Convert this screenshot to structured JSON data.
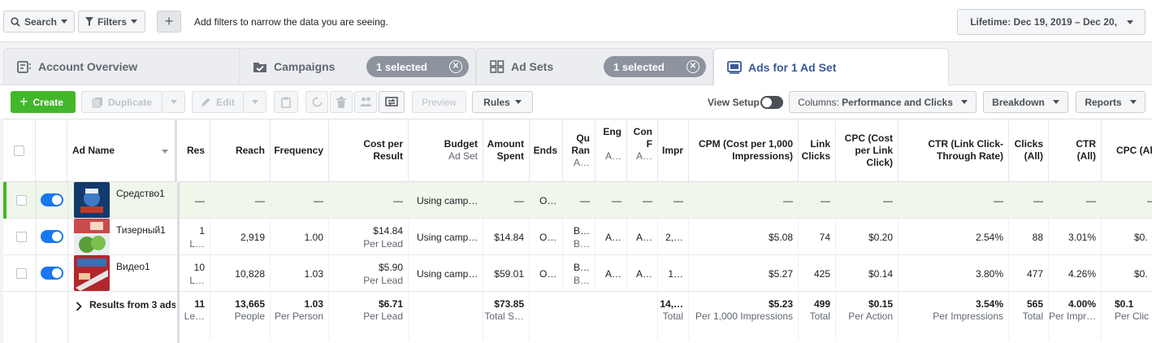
{
  "topbar": {
    "search_label": "Search",
    "filters_label": "Filters",
    "add_label": "+",
    "hint": "Add filters to narrow the data you are seeing.",
    "date_range": "Lifetime: Dec 19, 2019 – Dec 20,"
  },
  "tabs": {
    "account": "Account Overview",
    "campaigns": "Campaigns",
    "campaigns_selected": "1 selected",
    "adsets": "Ad Sets",
    "adsets_selected": "1 selected",
    "ads": "Ads for 1 Ad Set"
  },
  "toolbar": {
    "create": "Create",
    "duplicate": "Duplicate",
    "edit": "Edit",
    "preview": "Preview",
    "rules": "Rules",
    "view_setup": "View Setup",
    "columns_prefix": "Columns: ",
    "columns_value": "Performance and Clicks",
    "breakdown": "Breakdown",
    "reports": "Reports"
  },
  "columns": [
    {
      "key": "name",
      "label": "Ad Name",
      "sub": ""
    },
    {
      "key": "res",
      "label": "Res",
      "sub": ""
    },
    {
      "key": "reach",
      "label": "Reach",
      "sub": ""
    },
    {
      "key": "freq",
      "label": "Frequency",
      "sub": ""
    },
    {
      "key": "cpr",
      "label": "Cost per",
      "label2": "Result",
      "sub": ""
    },
    {
      "key": "budget",
      "label": "Budget",
      "label2": "",
      "sub": "Ad Set"
    },
    {
      "key": "amount",
      "label": "Amount",
      "label2": "Spent",
      "sub": ""
    },
    {
      "key": "ends",
      "label": "Ends",
      "sub": ""
    },
    {
      "key": "qrank",
      "label": "Qu",
      "label2": "Ran",
      "sub": "A…"
    },
    {
      "key": "eng",
      "label": "Eng",
      "label2": "",
      "sub": "A…"
    },
    {
      "key": "con",
      "label": "Con",
      "label2": "F",
      "sub": "A…"
    },
    {
      "key": "impr",
      "label": "Impr",
      "sub": ""
    },
    {
      "key": "cpm",
      "label": "CPM (Cost per 1,000",
      "label2": "Impressions)",
      "sub": ""
    },
    {
      "key": "link",
      "label": "Link",
      "label2": "Clicks",
      "sub": ""
    },
    {
      "key": "cpc",
      "label": "CPC (Cost",
      "label2": "per Link",
      "label3": "Click)",
      "sub": ""
    },
    {
      "key": "ctr",
      "label": "CTR (Link Click-",
      "label2": "Through Rate)",
      "sub": ""
    },
    {
      "key": "clicks",
      "label": "Clicks",
      "label2": "(All)",
      "sub": ""
    },
    {
      "key": "ctrall",
      "label": "CTR",
      "label2": "(All)",
      "sub": ""
    },
    {
      "key": "cpcall",
      "label": "CPC (Al",
      "sub": ""
    }
  ],
  "rows": [
    {
      "name": "Средство1",
      "res": "—",
      "res_sub": "",
      "reach": "—",
      "freq": "—",
      "cpr": "—",
      "cpr_sub": "",
      "budget": "Using camp…",
      "amount": "—",
      "ends": "O…",
      "qrank": "—",
      "qrank_sub": "",
      "eng": "—",
      "con": "—",
      "impr": "—",
      "cpm": "—",
      "link": "—",
      "cpc": "—",
      "ctr": "—",
      "clicks": "—",
      "ctrall": "—",
      "cpcall": "–"
    },
    {
      "name": "Тизерный1",
      "res": "1",
      "res_sub": "L…",
      "reach": "2,919",
      "freq": "1.00",
      "cpr": "$14.84",
      "cpr_sub": "Per Lead",
      "budget": "Using camp…",
      "amount": "$14.84",
      "ends": "O…",
      "qrank": "B…",
      "qrank_sub": "B…",
      "eng": "A…",
      "con": "A…",
      "impr": "2,…",
      "cpm": "$5.08",
      "link": "74",
      "cpc": "$0.20",
      "ctr": "2.54%",
      "clicks": "88",
      "ctrall": "3.01%",
      "cpcall": "$0."
    },
    {
      "name": "Видео1",
      "res": "10",
      "res_sub": "L…",
      "reach": "10,828",
      "freq": "1.03",
      "cpr": "$5.90",
      "cpr_sub": "Per Lead",
      "budget": "Using camp…",
      "amount": "$59.01",
      "ends": "O…",
      "qrank": "B…",
      "qrank_sub": "B…",
      "eng": "A…",
      "con": "A…",
      "impr": "1…",
      "cpm": "$5.27",
      "link": "425",
      "cpc": "$0.14",
      "ctr": "3.80%",
      "clicks": "477",
      "ctrall": "4.26%",
      "cpcall": "$0."
    }
  ],
  "totals": {
    "label": "Results from 3 ads",
    "res": "11",
    "res_sub": "Le…",
    "reach": "13,665",
    "reach_sub": "People",
    "freq": "1.03",
    "freq_sub": "Per Person",
    "cpr": "$6.71",
    "cpr_sub": "Per Lead",
    "amount": "$73.85",
    "amount_sub": "Total S…",
    "impr": "14,…",
    "impr_sub": "Total",
    "cpm": "$5.23",
    "cpm_sub": "Per 1,000 Impressions",
    "link": "499",
    "link_sub": "Total",
    "cpc": "$0.15",
    "cpc_sub": "Per Action",
    "ctr": "3.54%",
    "ctr_sub": "Per Impressions",
    "clicks": "565",
    "clicks_sub": "Total",
    "ctrall": "4.00%",
    "ctrall_sub": "Per Impr…",
    "cpcall": "$0.1",
    "cpcall_sub": "Per Clic"
  },
  "colors": {
    "accent": "#1877f2",
    "create_green": "#42b72a",
    "active_tab": "#3b5998"
  }
}
